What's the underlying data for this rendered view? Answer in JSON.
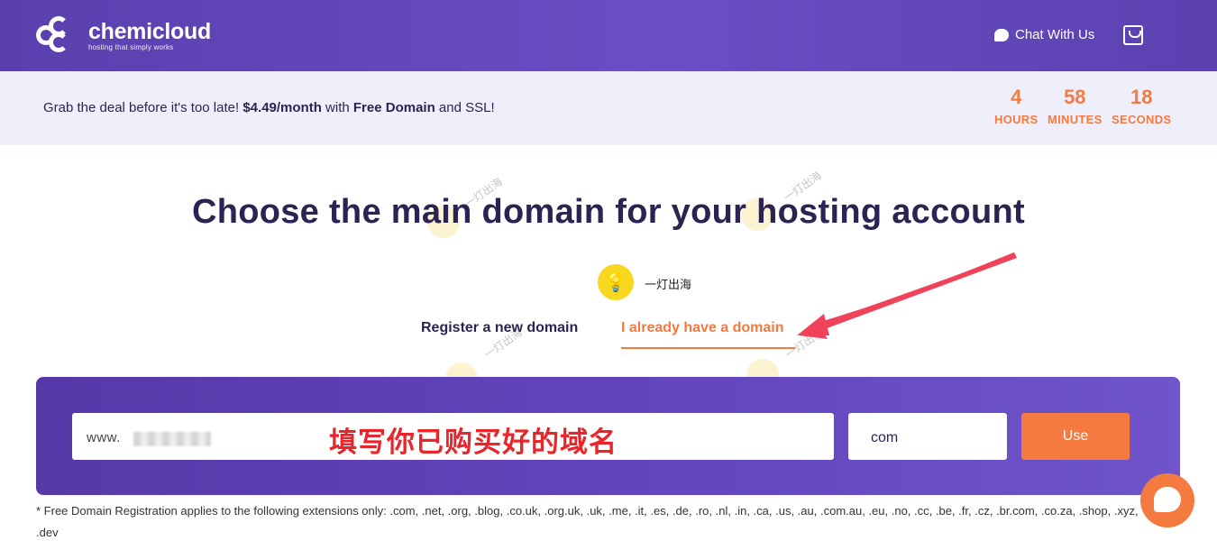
{
  "header": {
    "logo_name": "chemicloud",
    "logo_tagline": "hosting that simply works",
    "chat_label": "Chat With Us",
    "cart_icon": "cart-icon"
  },
  "promo": {
    "text_prefix": "Grab the deal before it's too late! ",
    "price": "$4.49/month",
    "text_mid": " with ",
    "free_domain": "Free Domain",
    "text_suffix": " and SSL!",
    "countdown": {
      "hours_value": "4",
      "hours_label": "HOURS",
      "minutes_value": "58",
      "minutes_label": "MINUTES",
      "seconds_value": "18",
      "seconds_label": "SECONDS"
    }
  },
  "main": {
    "title": "Choose the main domain for your hosting account",
    "badge_text": "一灯出海",
    "tabs": [
      {
        "label": "Register a new domain",
        "active": false
      },
      {
        "label": "I already have a domain",
        "active": true
      }
    ],
    "watermark_text": "一灯出海"
  },
  "domain_form": {
    "prefix": "www.",
    "annotation": "填写你已购买好的域名",
    "tld_value": "com",
    "use_label": "Use"
  },
  "note": "* Free Domain Registration applies to the following extensions only: .com, .net, .org, .blog, .co.uk, .org.uk, .uk, .me, .it, .es, .de, .ro, .nl, .in, .ca, .us, .au, .com.au, .eu, .no, .cc, .be, .fr, .cz, .br.com, .co.za, .shop, .xyz, .dev",
  "colors": {
    "brand_purple": "#5a3fae",
    "accent_orange": "#f47a3f",
    "annotation_red": "#e8252b"
  }
}
